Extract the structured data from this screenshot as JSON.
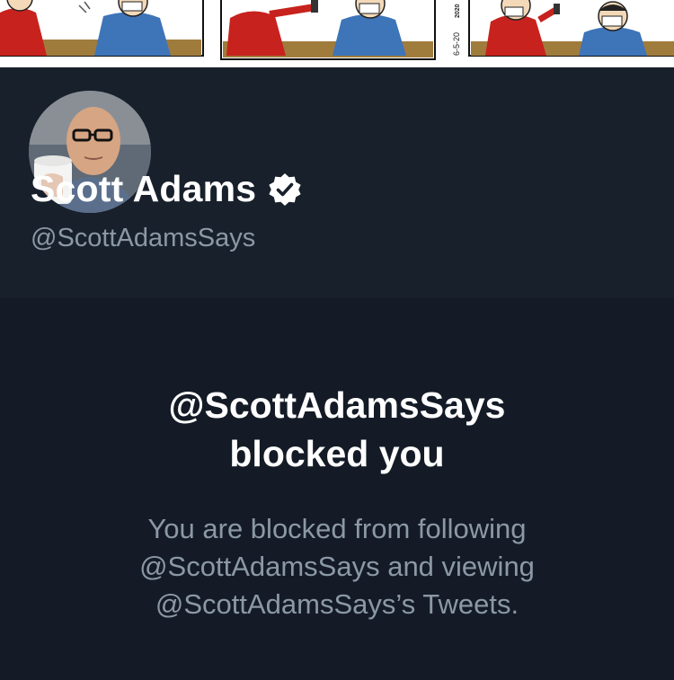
{
  "banner": {
    "comic_date": "6-5-20",
    "comic_year": "2020"
  },
  "profile": {
    "display_name": "Scott Adams",
    "handle": "@ScottAdamsSays",
    "verified_icon": "verified-badge",
    "avatar": "profile-photo"
  },
  "blocked": {
    "title_line1": "@ScottAdamsSays",
    "title_line2": "blocked you",
    "body_line1": "You are blocked from following",
    "body_line2": "@ScottAdamsSays and viewing",
    "body_line3": "@ScottAdamsSays’s Tweets."
  },
  "colors": {
    "background": "#141b26",
    "header_background": "#18202b",
    "primary_text": "#ffffff",
    "secondary_text": "#8b98a5"
  }
}
